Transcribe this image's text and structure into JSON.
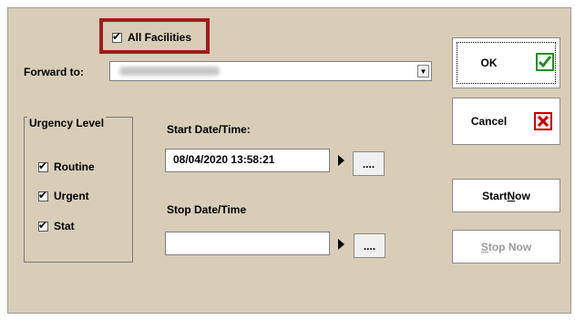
{
  "dialog": {
    "all_facilities_label": "All Facilities",
    "forward_to_label": "Forward to:",
    "urgency": {
      "title": "Urgency Level",
      "items": [
        {
          "label": "Routine",
          "checked": true
        },
        {
          "label": "Urgent",
          "checked": true
        },
        {
          "label": "Stat",
          "checked": true
        }
      ]
    },
    "start": {
      "label": "Start Date/Time:",
      "value": "08/04/2020 13:58:21",
      "picker_label": "...."
    },
    "stop": {
      "label": "Stop Date/Time",
      "value": "",
      "picker_label": "...."
    },
    "buttons": {
      "ok": "OK",
      "cancel": "Cancel",
      "start_now_prefix": "Start ",
      "start_now_underlined": "N",
      "start_now_suffix": "ow",
      "stop_now_underlined": "S",
      "stop_now_suffix": "top Now"
    }
  },
  "icons": {
    "checkmark": "check-icon",
    "ok_icon": "green-check-icon",
    "cancel_icon": "red-x-icon",
    "dropdown": "chevron-down-icon",
    "play": "triangle-right-icon"
  },
  "colors": {
    "dialog_bg": "#d9cdb8",
    "highlight": "#a01c1c",
    "ok_green": "#2a8a2a",
    "cancel_red": "#c00000",
    "disabled_text": "#9c9c9c"
  }
}
